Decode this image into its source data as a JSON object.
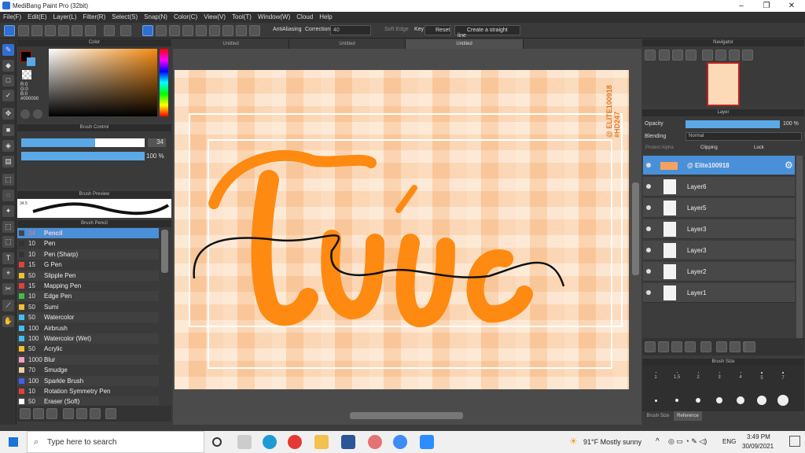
{
  "window": {
    "title": "MediBang Paint Pro (32bit)"
  },
  "menu": [
    "File(F)",
    "Edit(E)",
    "Layer(L)",
    "Filter(R)",
    "Select(S)",
    "Snap(N)",
    "Color(C)",
    "View(V)",
    "Tool(T)",
    "Window(W)",
    "Cloud",
    "Help"
  ],
  "toolbar": {
    "antialias": "AntiAliasing",
    "correction_label": "Correction",
    "correction_value": "40",
    "soft_edge": "Soft Edge",
    "key": "Key",
    "reset": "Reset",
    "straight_line": "Create a straight line"
  },
  "tabs": [
    "Untitled",
    "Untitled",
    "Untitled"
  ],
  "color_panel": {
    "title": "Color",
    "r": "R:0",
    "g": "G:0",
    "b": "B:0",
    "hex": "#000000"
  },
  "brush_control": {
    "title": "Brush Control",
    "size": "34",
    "opacity": "100 %"
  },
  "brush_preview": {
    "title": "Brush Preview",
    "value": "34.5"
  },
  "brush_list": {
    "title": "Brush Pencil",
    "items": [
      {
        "size": "34",
        "name": "Pencil",
        "color": "#444444",
        "selected": true
      },
      {
        "size": "10",
        "name": "Pen",
        "color": "#333333"
      },
      {
        "size": "10",
        "name": "Pen (Sharp)",
        "color": "#333333"
      },
      {
        "size": "15",
        "name": "G Pen",
        "color": "#e04040"
      },
      {
        "size": "50",
        "name": "Slipple Pen",
        "color": "#f0c030"
      },
      {
        "size": "15",
        "name": "Mapping Pen",
        "color": "#e04040"
      },
      {
        "size": "10",
        "name": "Edge Pen",
        "color": "#40c040"
      },
      {
        "size": "50",
        "name": "Sumi",
        "color": "#f0c030"
      },
      {
        "size": "50",
        "name": "Watercolor",
        "color": "#40c0f0"
      },
      {
        "size": "100",
        "name": "Airbrush",
        "color": "#40c0f0"
      },
      {
        "size": "100",
        "name": "Watercolor (Wet)",
        "color": "#40c0f0"
      },
      {
        "size": "50",
        "name": "Acrylic",
        "color": "#f0c030"
      },
      {
        "size": "1000",
        "name": "Blur",
        "color": "#f0a0c0"
      },
      {
        "size": "70",
        "name": "Smudge",
        "color": "#f0d0a0"
      },
      {
        "size": "100",
        "name": "Sparkle Brush",
        "color": "#4060f0"
      },
      {
        "size": "10",
        "name": "Rotation Symmetry Pen",
        "color": "#e04040"
      },
      {
        "size": "50",
        "name": "Eraser (Soft)",
        "color": "#ffffff"
      }
    ]
  },
  "canvas": {
    "watermark": "@ ELITE100918 #HD247",
    "lettering": "Túú"
  },
  "navigator": {
    "title": "Navigator"
  },
  "layer_panel": {
    "title": "Layer",
    "opacity_label": "Opacity",
    "opacity_value": "100 %",
    "blending_label": "Blending",
    "blending_value": "Normal",
    "protect_alpha": "Protect Alpha",
    "clipping": "Clipping",
    "lock": "Lock",
    "layers": [
      {
        "name": "@ Elite100918",
        "selected": true
      },
      {
        "name": "Layer6"
      },
      {
        "name": "Layer5"
      },
      {
        "name": "Layer3"
      },
      {
        "name": "Layer3"
      },
      {
        "name": "Layer2"
      },
      {
        "name": "Layer1"
      }
    ]
  },
  "brush_size": {
    "title": "Brush Size",
    "labels": [
      "1",
      "1.5",
      "2",
      "3",
      "4",
      "5",
      "7"
    ],
    "tab1": "Brush Size",
    "tab2": "Reference"
  },
  "taskbar": {
    "search": "Type here to search",
    "weather": "91°F  Mostly sunny",
    "lang": "ENG",
    "time": "3:49 PM",
    "date": "30/09/2021"
  }
}
